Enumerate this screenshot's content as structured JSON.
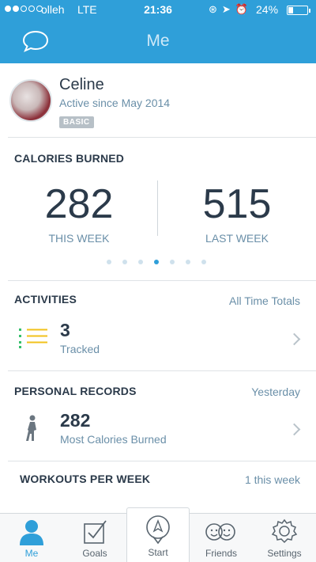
{
  "status_bar": {
    "carrier": "olleh",
    "network": "LTE",
    "time": "21:36",
    "battery": "24%",
    "signal_strength": 2
  },
  "header": {
    "title": "Me",
    "chat_icon": "speech-bubble-icon",
    "color": "#2f9fd9"
  },
  "profile": {
    "name": "Celine",
    "since": "Active since May 2014",
    "badge": "BASIC"
  },
  "calories": {
    "title": "CALORIES BURNED",
    "this_week_value": "282",
    "this_week_label": "THIS WEEK",
    "last_week_value": "515",
    "last_week_label": "LAST WEEK",
    "page_count": 7,
    "active_page": 4
  },
  "activities": {
    "title": "ACTIVITIES",
    "scope": "All Time Totals",
    "count": "3",
    "label": "Tracked",
    "icon": "list-icon"
  },
  "records": {
    "title": "PERSONAL RECORDS",
    "scope": "Yesterday",
    "value": "282",
    "label": "Most Calories Burned",
    "icon": "walking-person-icon"
  },
  "workouts": {
    "title": "WORKOUTS PER WEEK",
    "value": "1 this week"
  },
  "tabbar": {
    "tabs": [
      {
        "label": "Me",
        "icon": "person-icon",
        "active": true
      },
      {
        "label": "Goals",
        "icon": "goals-checkbox-icon",
        "active": false
      },
      {
        "label": "Start",
        "icon": "start-pin-icon",
        "active": false
      },
      {
        "label": "Friends",
        "icon": "friends-faces-icon",
        "active": false
      },
      {
        "label": "Settings",
        "icon": "gear-icon",
        "active": false
      }
    ]
  }
}
